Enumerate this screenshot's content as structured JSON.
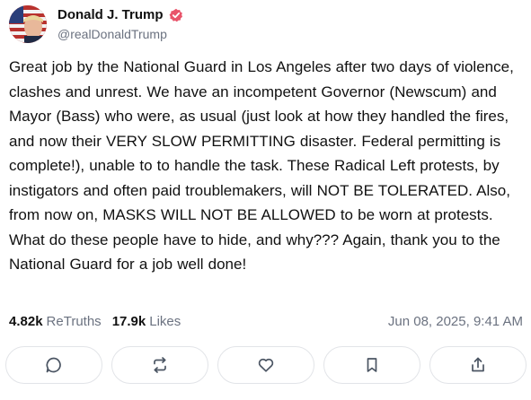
{
  "author": {
    "display_name": "Donald J. Trump",
    "handle": "@realDonaldTrump",
    "verified_icon": "verified-badge-icon",
    "verified_color": "#e8546a"
  },
  "post": {
    "text": "Great job by the National Guard in Los Angeles after two days of violence, clashes and unrest. We have an incompetent Governor (Newscum) and Mayor (Bass) who were, as usual (just look at how they handled the fires, and now their VERY SLOW PERMITTING disaster. Federal permitting is complete!), unable to to handle the task. These Radical Left protests, by instigators and often paid troublemakers, will NOT BE TOLERATED. Also, from now on, MASKS WILL NOT BE ALLOWED to be worn at protests. What do these people have to hide, and why??? Again, thank you to the National Guard for a job well done!"
  },
  "stats": {
    "retruths_count": "4.82k",
    "retruths_label": "ReTruths",
    "likes_count": "17.9k",
    "likes_label": "Likes",
    "timestamp": "Jun 08, 2025, 9:41 AM"
  },
  "actions": [
    {
      "icon": "reply-icon"
    },
    {
      "icon": "retruth-icon"
    },
    {
      "icon": "like-heart-icon"
    },
    {
      "icon": "bookmark-icon"
    },
    {
      "icon": "share-icon"
    }
  ],
  "colors": {
    "text": "#111111",
    "muted": "#6b7280",
    "border": "#e2e4e8",
    "icon": "#4b5563"
  }
}
